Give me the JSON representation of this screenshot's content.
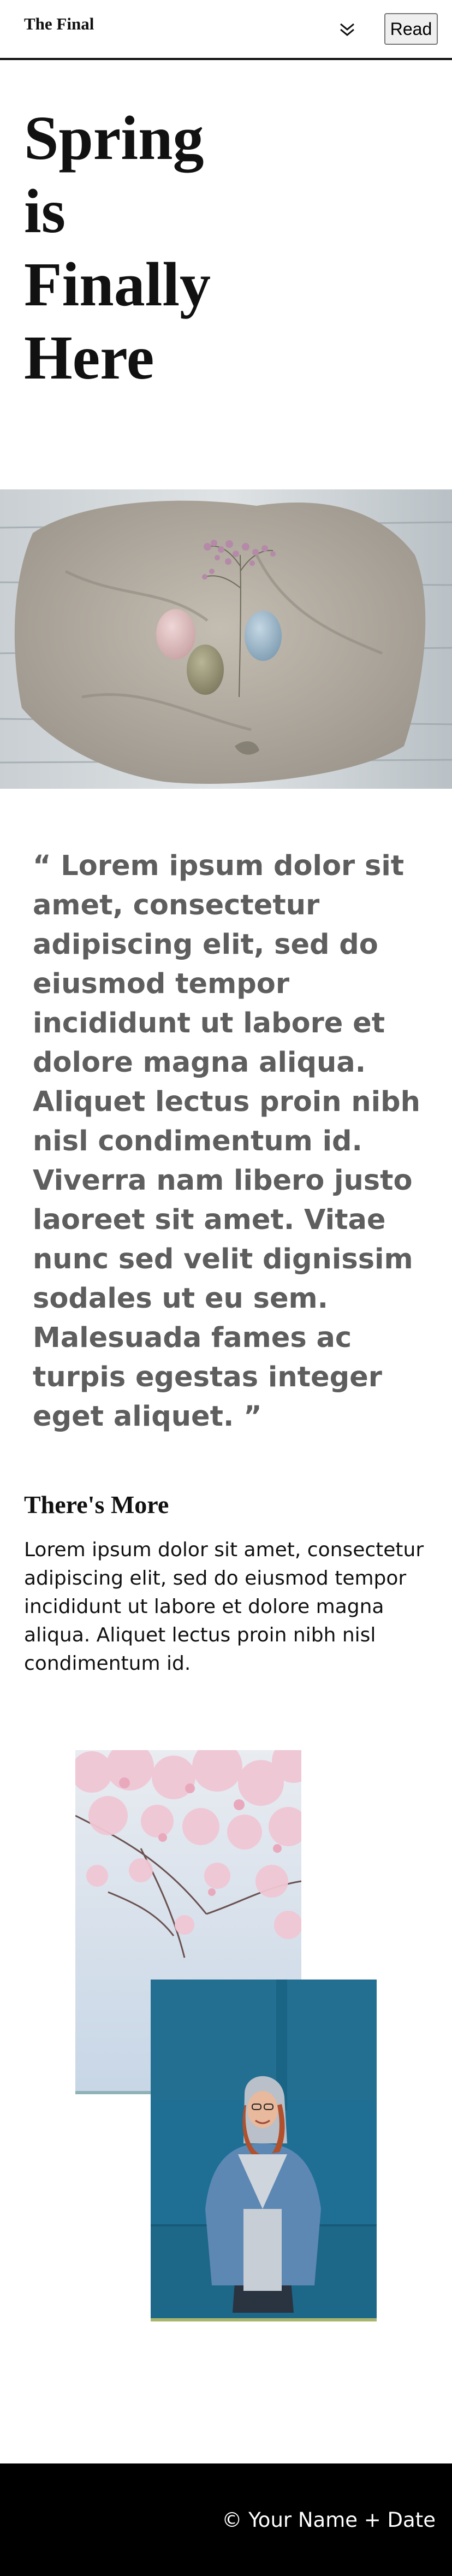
{
  "header": {
    "brand": "The Final",
    "menu_icon": "double-chevron-down-icon",
    "read_button": "Read"
  },
  "hero": {
    "title_lines": [
      "Spring",
      "is",
      "Finally",
      "Here"
    ]
  },
  "banner": {
    "image": "easter-eggs-on-linen-photo"
  },
  "quote": {
    "text": "“ Lorem ipsum dolor sit amet, consectetur adipiscing elit, sed do eiusmod tempor incididunt ut labore et dolore magna aliqua. Aliquet lectus proin nibh nisl condimentum id. Viverra nam libero justo laoreet sit amet. Vitae nunc sed velit dignissim sodales ut eu sem. Malesuada fames ac turpis egestas integer eget aliquet. ”"
  },
  "more": {
    "title": "There's More",
    "body": "Lorem ipsum dolor sit amet, consectetur adipiscing elit, sed do eiusmod tempor incididunt ut labore et dolore magna aliqua. Aliquet lectus proin nibh nisl condimentum id."
  },
  "gallery": {
    "images": [
      "cherry-blossom-photo",
      "woman-denim-jacket-photo"
    ]
  },
  "footer": {
    "copyright": "© Your Name + Date"
  },
  "colors": {
    "ink": "#111111",
    "quote_gray": "#5e5e5e",
    "footer_bg": "#000000",
    "wall_blue": "#1f6f94"
  }
}
